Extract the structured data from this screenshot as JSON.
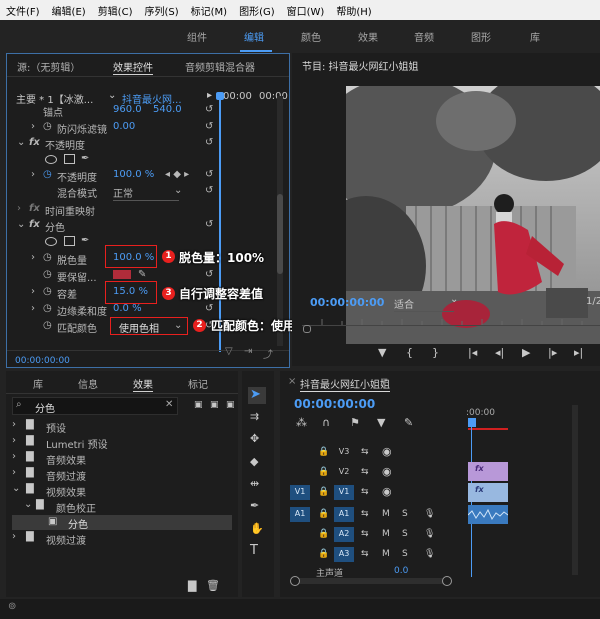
{
  "menubar": [
    "文件(F)",
    "编辑(E)",
    "剪辑(C)",
    "序列(S)",
    "标记(M)",
    "图形(G)",
    "窗口(W)",
    "帮助(H)"
  ],
  "workspaces": [
    "组件",
    "编辑",
    "颜色",
    "效果",
    "音频",
    "图形",
    "库"
  ],
  "source_panel": {
    "tabs": [
      "源:（无剪辑）",
      "效果控件",
      "音频剪辑混合器"
    ],
    "master_label": "主要 * 1【冰激...",
    "sequence_label": "抖音最火网...",
    "ruler_start": "00:00",
    "ruler_end": "00:00",
    "rows": [
      {
        "label": "锚点",
        "value": "960.0",
        "value2": "540.0"
      },
      {
        "label": "防闪烁滤镜",
        "value": "0.00"
      },
      {
        "label": "不透明度"
      },
      {
        "label": "不透明度",
        "value": "100.0 %"
      },
      {
        "label": "混合模式",
        "value": "正常"
      },
      {
        "label": "时间重映射"
      },
      {
        "label": "分色"
      },
      {
        "label": "脱色量",
        "value": "100.0 %"
      },
      {
        "label": "要保留..."
      },
      {
        "label": "容差",
        "value": "15.0 %"
      },
      {
        "label": "边缘柔和度",
        "value": "0.0 %"
      },
      {
        "label": "匹配颜色",
        "value": "使用色相"
      }
    ],
    "timecode": "00:00:00:00"
  },
  "annotations": [
    {
      "num": "1",
      "text": "脱色量：100%"
    },
    {
      "num": "2",
      "text": "匹配颜色：使用色相"
    },
    {
      "num": "3",
      "text": "自行调整容差值"
    }
  ],
  "program_panel": {
    "title": "节目: 抖音最火网红小姐姐",
    "timecode": "00:00:00:00",
    "fit": "适合",
    "ratio": "1/2"
  },
  "project_panel": {
    "tabs": [
      "库",
      "信息",
      "效果",
      "标记"
    ],
    "search_value": "分色",
    "tree": [
      {
        "label": "预设",
        "level": 0
      },
      {
        "label": "Lumetri 预设",
        "level": 0
      },
      {
        "label": "音频效果",
        "level": 0
      },
      {
        "label": "音频过渡",
        "level": 0
      },
      {
        "label": "视频效果",
        "level": 0
      },
      {
        "label": "颜色校正",
        "level": 1
      },
      {
        "label": "分色",
        "level": 2
      },
      {
        "label": "视频过渡",
        "level": 0
      }
    ]
  },
  "timeline": {
    "title": "抖音最火网红小姐姐",
    "timecode": "00:00:00:00",
    "ruler_label": ":00:00",
    "tracks": [
      {
        "name": "V3",
        "type": "video"
      },
      {
        "name": "V2",
        "type": "video"
      },
      {
        "name": "V1",
        "type": "video",
        "src": "V1"
      },
      {
        "name": "A1",
        "type": "audio",
        "src": "A1"
      },
      {
        "name": "A2",
        "type": "audio"
      },
      {
        "name": "A3",
        "type": "audio"
      }
    ],
    "master_label": "主声道",
    "master_value": "0.0",
    "clip_mark": "fx"
  },
  "colors": {
    "accent": "#4c9cf5",
    "annotation": "#e8201e",
    "swatch": "#b02c3a"
  }
}
